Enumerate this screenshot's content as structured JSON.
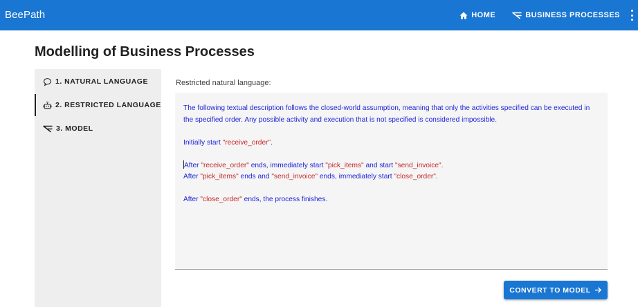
{
  "app": {
    "title": "BeePath"
  },
  "nav": {
    "home": {
      "label": "HOME",
      "icon": "home-icon"
    },
    "business_processes": {
      "label": "BUSINESS PROCESSES",
      "icon": "process-icon"
    },
    "more": {
      "icon": "more-vert-icon"
    }
  },
  "page": {
    "title": "Modelling of Business Processes"
  },
  "steps": [
    {
      "label": "1. NATURAL LANGUAGE",
      "icon": "chat-bubble-icon",
      "active": false
    },
    {
      "label": "2. RESTRICTED LANGUAGE",
      "icon": "robot-icon",
      "active": true
    },
    {
      "label": "3. MODEL",
      "icon": "process-icon",
      "active": false
    }
  ],
  "editor": {
    "label": "Restricted natural language:",
    "intro": "The following textual description follows the closed-world assumption, meaning that only the activities specified can be executed in the specified order. Any possible activity and execution that is not specified is considered impossible.",
    "line1": {
      "a": "Initially start ",
      "b": "\"receive_order\"",
      "c": "."
    },
    "line2": {
      "a": "After ",
      "b": "\"receive_order\"",
      "c": " ends, immediately start ",
      "d": "\"pick_items\"",
      "e": " and start ",
      "f": "\"send_invoice\"",
      "g": "."
    },
    "line3": {
      "a": "After ",
      "b": "\"pick_items\"",
      "c": " ends and ",
      "d": "\"send_invoice\"",
      "e": " ends, immediately start ",
      "f": "\"close_order\"",
      "g": "."
    },
    "line4": {
      "a": "After ",
      "b": "\"close_order\"",
      "c": " ends, the process finishes."
    }
  },
  "actions": {
    "convert": "CONVERT TO MODEL"
  },
  "colors": {
    "primary": "#1976d2",
    "text_blue": "#1f24d6",
    "quote_red": "#c62828",
    "sidebar_bg": "#eeeeee"
  }
}
